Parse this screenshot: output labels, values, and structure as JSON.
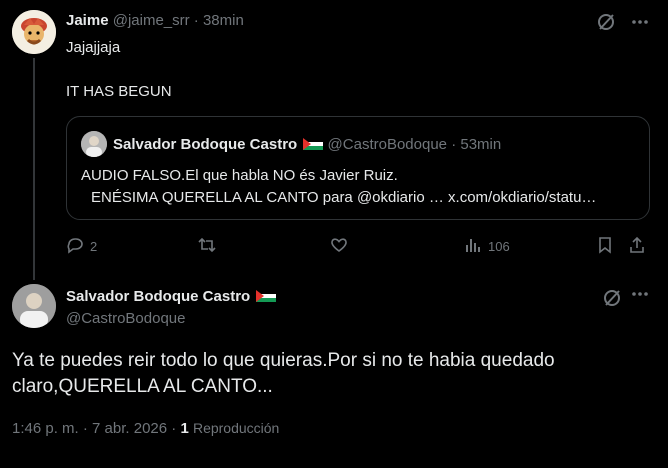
{
  "colors": {
    "background": "#000000",
    "text": "#e7e9ea",
    "muted": "#71767b",
    "border": "#2f3336"
  },
  "reply": {
    "author_name": "Jaime",
    "author_handle": "@jaime_srr",
    "time": "· 38min",
    "text_line1": "Jajajjaja",
    "text_line2": "IT HAS BEGUN",
    "quote": {
      "author_name": "Salvador Bodoque Castro",
      "author_handle": "@CastroBodoque",
      "time": "· 53min",
      "line1": "AUDIO FALSO.El que habla NO és Javier Ruiz.",
      "line2": "ENÉSIMA QUERELLA AL CANTO para @okdiario … x.com/okdiario/statu…"
    },
    "actions": {
      "reply_count": "2",
      "retweet_count": "",
      "like_count": "",
      "views_count": "106"
    }
  },
  "main_post": {
    "author_name": "Salvador Bodoque Castro",
    "author_handle": "@CastroBodoque",
    "text": "Ya te puedes reir todo lo que quieras.Por si no te habia quedado claro,QUERELLA AL CANTO...",
    "timestamp": "1:46 p. m. · 7 abr. 2026 ·",
    "views_count": "1",
    "views_label": "Reproducción"
  },
  "icons": [
    "grok-icon",
    "more-icon",
    "reply-icon",
    "retweet-icon",
    "like-icon",
    "views-icon",
    "bookmark-icon",
    "share-icon",
    "flag-icon"
  ]
}
